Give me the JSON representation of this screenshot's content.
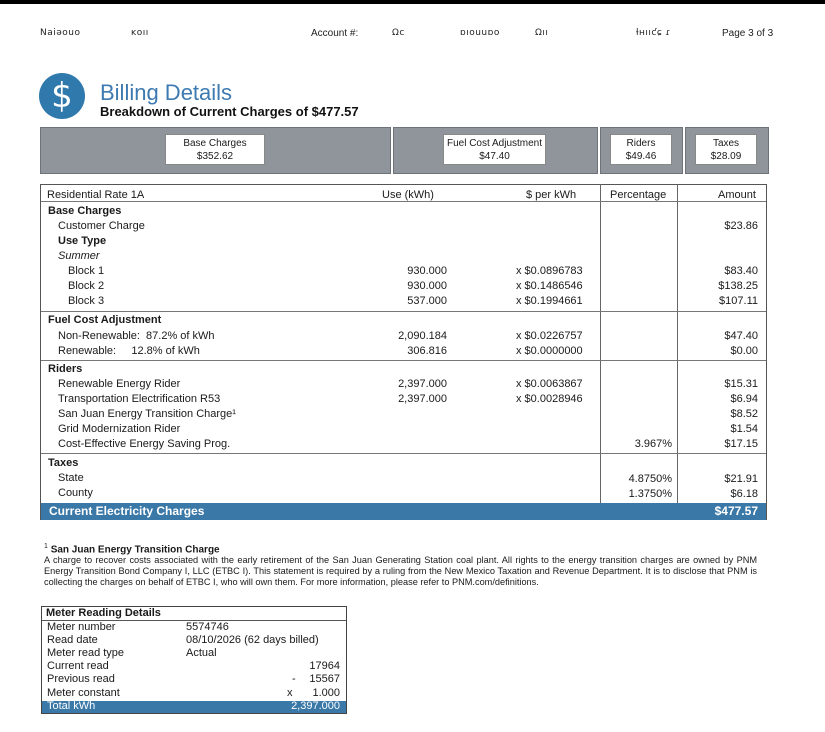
{
  "header": {
    "name_label": "Naiǝouo",
    "name_value": "ĸoıı",
    "account_label": "Account #:",
    "account_value": "Ωc",
    "scribble_1": "ɒıouuɒo",
    "scribble_2": "Ωıı",
    "scribble_3": "ƚʜııƈɕ  ɾ",
    "page_label": "Page 3 of 3"
  },
  "title": {
    "icon": "dollar-circle-icon",
    "heading": "Billing Details",
    "subheading": "Breakdown of Current Charges of $477.57"
  },
  "summary": [
    {
      "label": "Base Charges",
      "value": "$352.62"
    },
    {
      "label": "Fuel Cost Adjustment",
      "value": "$47.40"
    },
    {
      "label": "Riders",
      "value": "$49.46"
    },
    {
      "label": "Taxes",
      "value": "$28.09"
    }
  ],
  "table": {
    "rate_name": "Residential Rate 1A",
    "columns": {
      "use": "Use (kWh)",
      "rate": "$ per kWh",
      "pct": "Percentage",
      "amount": "Amount"
    },
    "base": {
      "heading": "Base Charges",
      "customer_charge_label": "Customer Charge",
      "customer_charge_amount": "$23.86",
      "use_type_label": "Use Type",
      "season": "Summer",
      "blocks": [
        {
          "label": "Block 1",
          "use": "930.000",
          "rate": "x $0.0896783",
          "amount": "$83.40"
        },
        {
          "label": "Block 2",
          "use": "930.000",
          "rate": "x $0.1486546",
          "amount": "$138.25"
        },
        {
          "label": "Block 3",
          "use": "537.000",
          "rate": "x $0.1994661",
          "amount": "$107.11"
        }
      ]
    },
    "fuel": {
      "heading": "Fuel Cost Adjustment",
      "rows": [
        {
          "label": "Non-Renewable:  87.2% of kWh",
          "use": "2,090.184",
          "rate": "x $0.0226757",
          "amount": "$47.40"
        },
        {
          "label": "Renewable:     12.8% of kWh",
          "use": "306.816",
          "rate": "x $0.0000000",
          "amount": "$0.00"
        }
      ]
    },
    "riders": {
      "heading": "Riders",
      "rows": [
        {
          "label": "Renewable Energy Rider",
          "use": "2,397.000",
          "rate": "x $0.0063867",
          "pct": "",
          "amount": "$15.31"
        },
        {
          "label": "Transportation Electrification R53",
          "use": "2,397.000",
          "rate": "x $0.0028946",
          "pct": "",
          "amount": "$6.94"
        },
        {
          "label": "San Juan Energy Transition Charge¹",
          "use": "",
          "rate": "",
          "pct": "",
          "amount": "$8.52"
        },
        {
          "label": "Grid Modernization Rider",
          "use": "",
          "rate": "",
          "pct": "",
          "amount": "$1.54"
        },
        {
          "label": "Cost-Effective Energy Saving Prog.",
          "use": "",
          "rate": "",
          "pct": "3.967%",
          "amount": "$17.15"
        }
      ]
    },
    "taxes": {
      "heading": "Taxes",
      "rows": [
        {
          "label": "State",
          "pct": "4.8750%",
          "amount": "$21.91"
        },
        {
          "label": "County",
          "pct": "1.3750%",
          "amount": "$6.18"
        }
      ]
    },
    "total_label": "Current Electricity Charges",
    "total_amount": "$477.57"
  },
  "footnote": {
    "marker": "1",
    "title": "San Juan Energy Transition Charge",
    "text": "A charge to recover costs associated with the early retirement of the San Juan Generating Station coal plant. All rights to the energy transition charges are owned by PNM Energy Transition Bond Company I, LLC (ETBC I). This statement is required by a ruling from the New Mexico Taxation and Revenue Department. It is to disclose that PNM is collecting the charges on behalf of ETBC I, who will own them. For more information, please refer to PNM.com/definitions."
  },
  "meter": {
    "heading": "Meter Reading Details",
    "number_label": "Meter number",
    "number_value": "5574746",
    "date_label": "Read date",
    "date_value": "08/10/2026 (62 days billed)",
    "type_label": "Meter read type",
    "type_value": "Actual",
    "current_label": "Current read",
    "current_value": "17964",
    "previous_label": "Previous read",
    "previous_op": "-",
    "previous_value": "15567",
    "constant_label": "Meter constant",
    "constant_op": "x",
    "constant_value": "1.000",
    "total_label": "Total kWh",
    "total_value": "2,397.000"
  }
}
